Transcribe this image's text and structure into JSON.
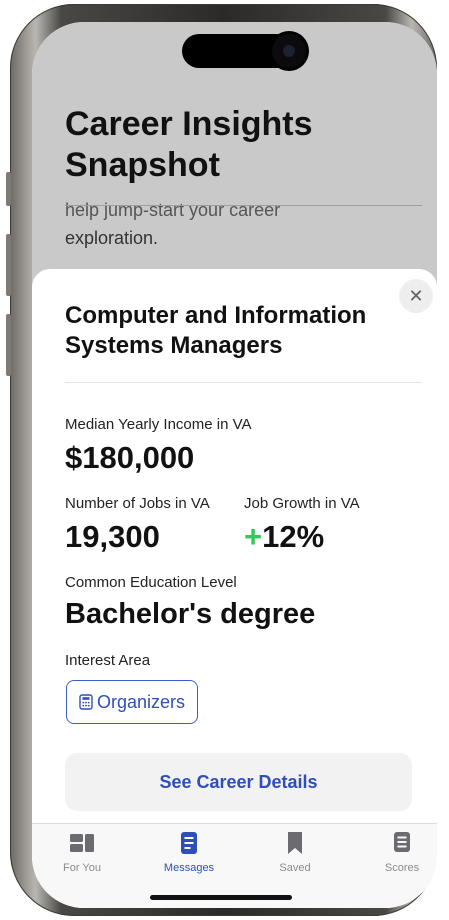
{
  "header": {
    "title": "Career Insights Snapshot",
    "intro_partial": "help jump-start your career",
    "intro_end": "exploration."
  },
  "sheet": {
    "close_label": "✕",
    "career_title": "Computer and Information Systems Managers",
    "income_label": "Median Yearly Income in VA",
    "income_value": "$180,000",
    "jobs_label": "Number of Jobs in VA",
    "jobs_value": "19,300",
    "growth_label": "Job Growth in VA",
    "growth_sign": "+",
    "growth_value": "12%",
    "education_label": "Common Education Level",
    "education_value": "Bachelor's degree",
    "interest_label": "Interest Area",
    "interest_chip": "Organizers",
    "details_button": "See Career Details"
  },
  "tabbar": {
    "tabs": [
      {
        "label": "For You",
        "icon": "grid-icon"
      },
      {
        "label": "Messages",
        "icon": "message-icon"
      },
      {
        "label": "Saved",
        "icon": "bookmark-icon"
      },
      {
        "label": "Scores",
        "icon": "scores-icon"
      }
    ],
    "active_index": 1
  },
  "colors": {
    "accent": "#2f4fb8",
    "growth": "#34c759",
    "header_bg": "#c9c9c9"
  }
}
